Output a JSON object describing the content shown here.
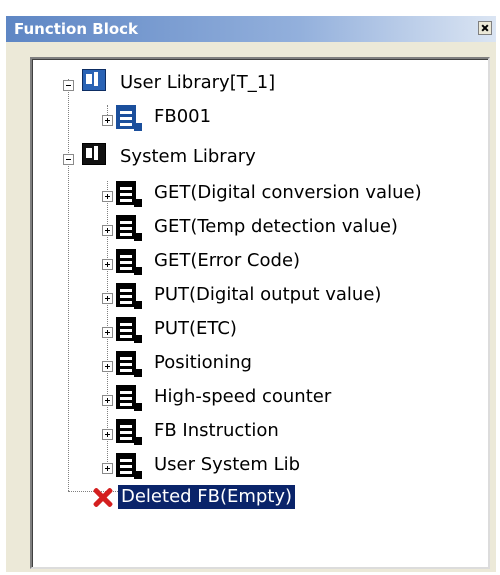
{
  "window": {
    "title": "Function Block"
  },
  "tree": {
    "user_library": {
      "label": "User Library[T_1]",
      "children": [
        {
          "label": "FB001"
        }
      ]
    },
    "system_library": {
      "label": "System Library",
      "children": [
        {
          "label": "GET(Digital conversion value)"
        },
        {
          "label": "GET(Temp detection value)"
        },
        {
          "label": "GET(Error Code)"
        },
        {
          "label": "PUT(Digital output value)"
        },
        {
          "label": "PUT(ETC)"
        },
        {
          "label": "Positioning"
        },
        {
          "label": "High-speed counter"
        },
        {
          "label": "FB Instruction"
        },
        {
          "label": "User System Lib"
        }
      ]
    },
    "deleted": {
      "label": "Deleted FB(Empty)"
    }
  },
  "colors": {
    "titlebar": "#5e86c4",
    "selection": "#0a246a",
    "delete": "#d41f1f"
  }
}
